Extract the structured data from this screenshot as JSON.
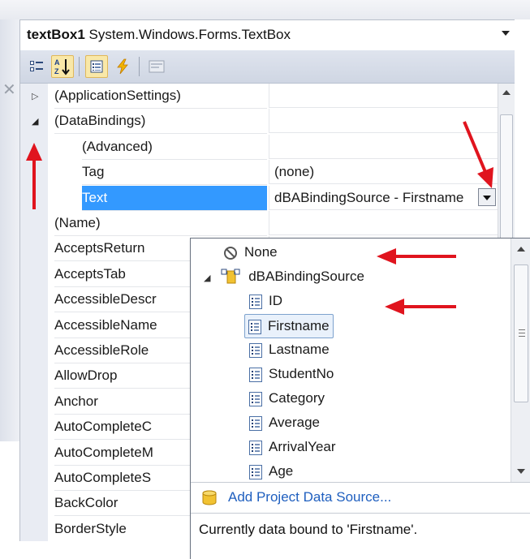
{
  "object_selector": {
    "name": "textBox1",
    "type": "System.Windows.Forms.TextBox"
  },
  "toolbar": {
    "buttons": [
      "categorized-icon",
      "alphabetical-icon",
      "properties-icon",
      "events-icon",
      "property-pages-icon"
    ],
    "alphabetical_label": "A Z"
  },
  "properties": [
    {
      "name": "(ApplicationSettings)",
      "value": "",
      "expander": "closed"
    },
    {
      "name": "(DataBindings)",
      "value": "",
      "expander": "open"
    },
    {
      "name": "(Advanced)",
      "value": "",
      "sub": true
    },
    {
      "name": "Tag",
      "value": "(none)",
      "sub": true
    },
    {
      "name": "Text",
      "value": "dBABindingSource - Firstname",
      "sub": true,
      "selected": true
    },
    {
      "name": "(Name)",
      "value": ""
    },
    {
      "name": "AcceptsReturn",
      "value": ""
    },
    {
      "name": "AcceptsTab",
      "value": ""
    },
    {
      "name": "AccessibleDescr",
      "value": ""
    },
    {
      "name": "AccessibleName",
      "value": ""
    },
    {
      "name": "AccessibleRole",
      "value": ""
    },
    {
      "name": "AllowDrop",
      "value": ""
    },
    {
      "name": "Anchor",
      "value": ""
    },
    {
      "name": "AutoCompleteC",
      "value": ""
    },
    {
      "name": "AutoCompleteM",
      "value": ""
    },
    {
      "name": "AutoCompleteS",
      "value": ""
    },
    {
      "name": "BackColor",
      "value": ""
    },
    {
      "name": "BorderStyle",
      "value": ""
    }
  ],
  "binding_popup": {
    "none_label": "None",
    "source_label": "dBABindingSource",
    "fields": [
      "ID",
      "Firstname",
      "Lastname",
      "StudentNo",
      "Category",
      "Average",
      "ArrivalYear",
      "Age"
    ],
    "selected_field": "Firstname",
    "add_link": "Add Project Data Source...",
    "status": "Currently data bound to 'Firstname'."
  },
  "colors": {
    "selection": "#3399ff",
    "annotation_arrow": "#e0141e",
    "link": "#1f5fbf"
  }
}
